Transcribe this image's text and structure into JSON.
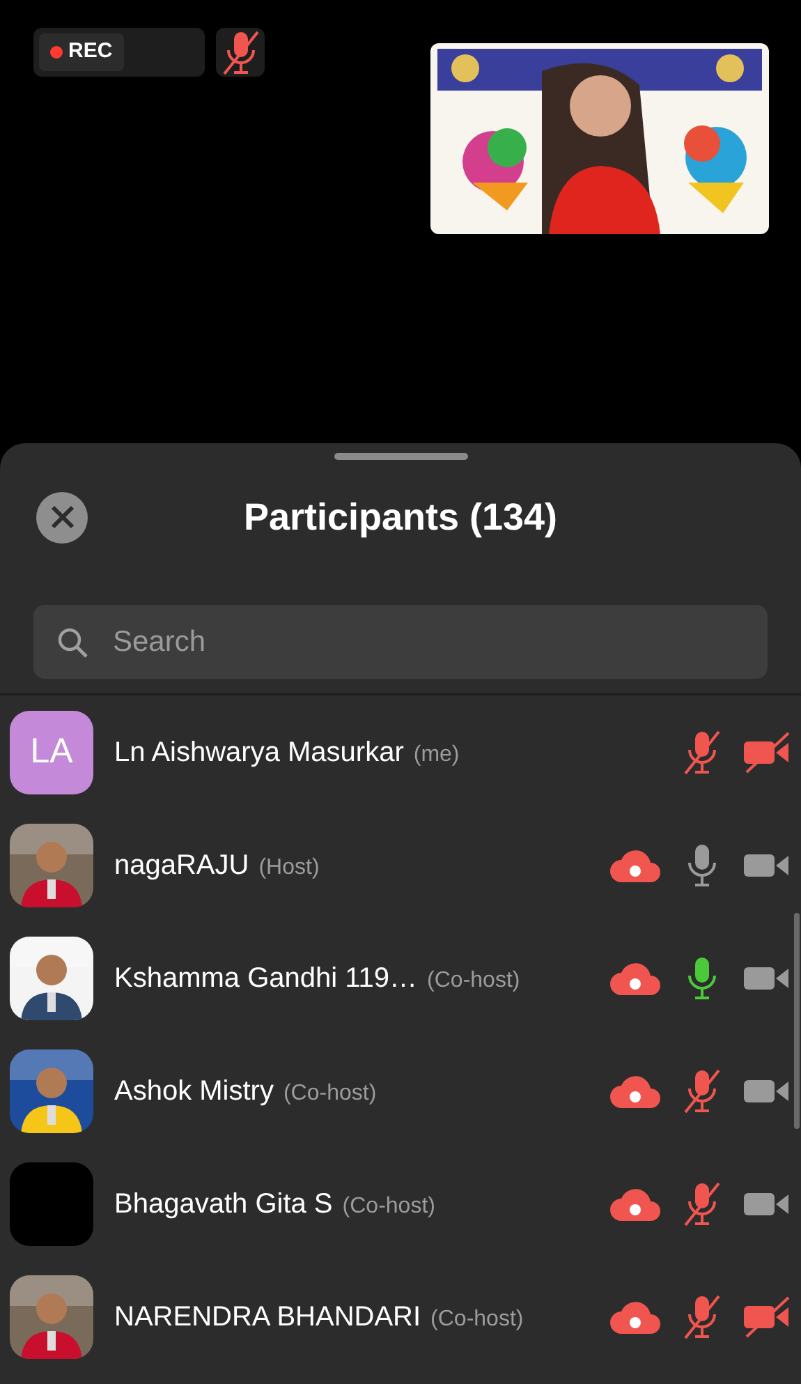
{
  "recording": {
    "label": "REC"
  },
  "mic_button": {
    "muted": true
  },
  "panel": {
    "title": "Participants (134)",
    "search": {
      "placeholder": "Search"
    }
  },
  "rows": [
    {
      "name": "Ln Aishwarya Masurkar",
      "role": "(me)",
      "avatar": {
        "kind": "initials",
        "text": "LA",
        "color": "#c489d8"
      },
      "cloud": false,
      "mic_muted": true,
      "video": false
    },
    {
      "name": "nagaRAJU",
      "role": "(Host)",
      "cloud": true,
      "mic_muted": false,
      "speaking": false,
      "video": true
    },
    {
      "name": "Kshamma Gandhi 119…",
      "role": "(Co-host)",
      "cloud": true,
      "mic_muted": false,
      "speaking": true,
      "video": true
    },
    {
      "name": "Ashok Mistry",
      "role": "(Co-host)",
      "cloud": true,
      "mic_muted": true,
      "video": true
    },
    {
      "name": "Bhagavath Gita S",
      "role": "(Co-host)",
      "avatar": {
        "kind": "blank"
      },
      "cloud": true,
      "mic_muted": true,
      "video": true
    },
    {
      "name": "NARENDRA BHANDARI",
      "role": "(Co-host)",
      "cloud": true,
      "mic_muted": true,
      "video": false
    }
  ]
}
